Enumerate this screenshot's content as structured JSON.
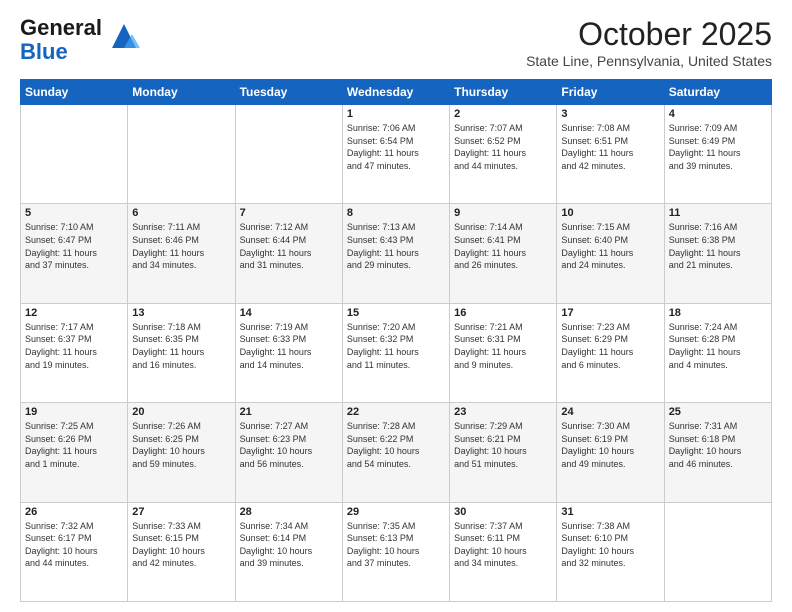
{
  "header": {
    "logo_line1": "General",
    "logo_line2": "Blue",
    "title": "October 2025",
    "subtitle": "State Line, Pennsylvania, United States"
  },
  "days_of_week": [
    "Sunday",
    "Monday",
    "Tuesday",
    "Wednesday",
    "Thursday",
    "Friday",
    "Saturday"
  ],
  "weeks": [
    [
      {
        "day": "",
        "info": ""
      },
      {
        "day": "",
        "info": ""
      },
      {
        "day": "",
        "info": ""
      },
      {
        "day": "1",
        "info": "Sunrise: 7:06 AM\nSunset: 6:54 PM\nDaylight: 11 hours\nand 47 minutes."
      },
      {
        "day": "2",
        "info": "Sunrise: 7:07 AM\nSunset: 6:52 PM\nDaylight: 11 hours\nand 44 minutes."
      },
      {
        "day": "3",
        "info": "Sunrise: 7:08 AM\nSunset: 6:51 PM\nDaylight: 11 hours\nand 42 minutes."
      },
      {
        "day": "4",
        "info": "Sunrise: 7:09 AM\nSunset: 6:49 PM\nDaylight: 11 hours\nand 39 minutes."
      }
    ],
    [
      {
        "day": "5",
        "info": "Sunrise: 7:10 AM\nSunset: 6:47 PM\nDaylight: 11 hours\nand 37 minutes."
      },
      {
        "day": "6",
        "info": "Sunrise: 7:11 AM\nSunset: 6:46 PM\nDaylight: 11 hours\nand 34 minutes."
      },
      {
        "day": "7",
        "info": "Sunrise: 7:12 AM\nSunset: 6:44 PM\nDaylight: 11 hours\nand 31 minutes."
      },
      {
        "day": "8",
        "info": "Sunrise: 7:13 AM\nSunset: 6:43 PM\nDaylight: 11 hours\nand 29 minutes."
      },
      {
        "day": "9",
        "info": "Sunrise: 7:14 AM\nSunset: 6:41 PM\nDaylight: 11 hours\nand 26 minutes."
      },
      {
        "day": "10",
        "info": "Sunrise: 7:15 AM\nSunset: 6:40 PM\nDaylight: 11 hours\nand 24 minutes."
      },
      {
        "day": "11",
        "info": "Sunrise: 7:16 AM\nSunset: 6:38 PM\nDaylight: 11 hours\nand 21 minutes."
      }
    ],
    [
      {
        "day": "12",
        "info": "Sunrise: 7:17 AM\nSunset: 6:37 PM\nDaylight: 11 hours\nand 19 minutes."
      },
      {
        "day": "13",
        "info": "Sunrise: 7:18 AM\nSunset: 6:35 PM\nDaylight: 11 hours\nand 16 minutes."
      },
      {
        "day": "14",
        "info": "Sunrise: 7:19 AM\nSunset: 6:33 PM\nDaylight: 11 hours\nand 14 minutes."
      },
      {
        "day": "15",
        "info": "Sunrise: 7:20 AM\nSunset: 6:32 PM\nDaylight: 11 hours\nand 11 minutes."
      },
      {
        "day": "16",
        "info": "Sunrise: 7:21 AM\nSunset: 6:31 PM\nDaylight: 11 hours\nand 9 minutes."
      },
      {
        "day": "17",
        "info": "Sunrise: 7:23 AM\nSunset: 6:29 PM\nDaylight: 11 hours\nand 6 minutes."
      },
      {
        "day": "18",
        "info": "Sunrise: 7:24 AM\nSunset: 6:28 PM\nDaylight: 11 hours\nand 4 minutes."
      }
    ],
    [
      {
        "day": "19",
        "info": "Sunrise: 7:25 AM\nSunset: 6:26 PM\nDaylight: 11 hours\nand 1 minute."
      },
      {
        "day": "20",
        "info": "Sunrise: 7:26 AM\nSunset: 6:25 PM\nDaylight: 10 hours\nand 59 minutes."
      },
      {
        "day": "21",
        "info": "Sunrise: 7:27 AM\nSunset: 6:23 PM\nDaylight: 10 hours\nand 56 minutes."
      },
      {
        "day": "22",
        "info": "Sunrise: 7:28 AM\nSunset: 6:22 PM\nDaylight: 10 hours\nand 54 minutes."
      },
      {
        "day": "23",
        "info": "Sunrise: 7:29 AM\nSunset: 6:21 PM\nDaylight: 10 hours\nand 51 minutes."
      },
      {
        "day": "24",
        "info": "Sunrise: 7:30 AM\nSunset: 6:19 PM\nDaylight: 10 hours\nand 49 minutes."
      },
      {
        "day": "25",
        "info": "Sunrise: 7:31 AM\nSunset: 6:18 PM\nDaylight: 10 hours\nand 46 minutes."
      }
    ],
    [
      {
        "day": "26",
        "info": "Sunrise: 7:32 AM\nSunset: 6:17 PM\nDaylight: 10 hours\nand 44 minutes."
      },
      {
        "day": "27",
        "info": "Sunrise: 7:33 AM\nSunset: 6:15 PM\nDaylight: 10 hours\nand 42 minutes."
      },
      {
        "day": "28",
        "info": "Sunrise: 7:34 AM\nSunset: 6:14 PM\nDaylight: 10 hours\nand 39 minutes."
      },
      {
        "day": "29",
        "info": "Sunrise: 7:35 AM\nSunset: 6:13 PM\nDaylight: 10 hours\nand 37 minutes."
      },
      {
        "day": "30",
        "info": "Sunrise: 7:37 AM\nSunset: 6:11 PM\nDaylight: 10 hours\nand 34 minutes."
      },
      {
        "day": "31",
        "info": "Sunrise: 7:38 AM\nSunset: 6:10 PM\nDaylight: 10 hours\nand 32 minutes."
      },
      {
        "day": "",
        "info": ""
      }
    ]
  ]
}
